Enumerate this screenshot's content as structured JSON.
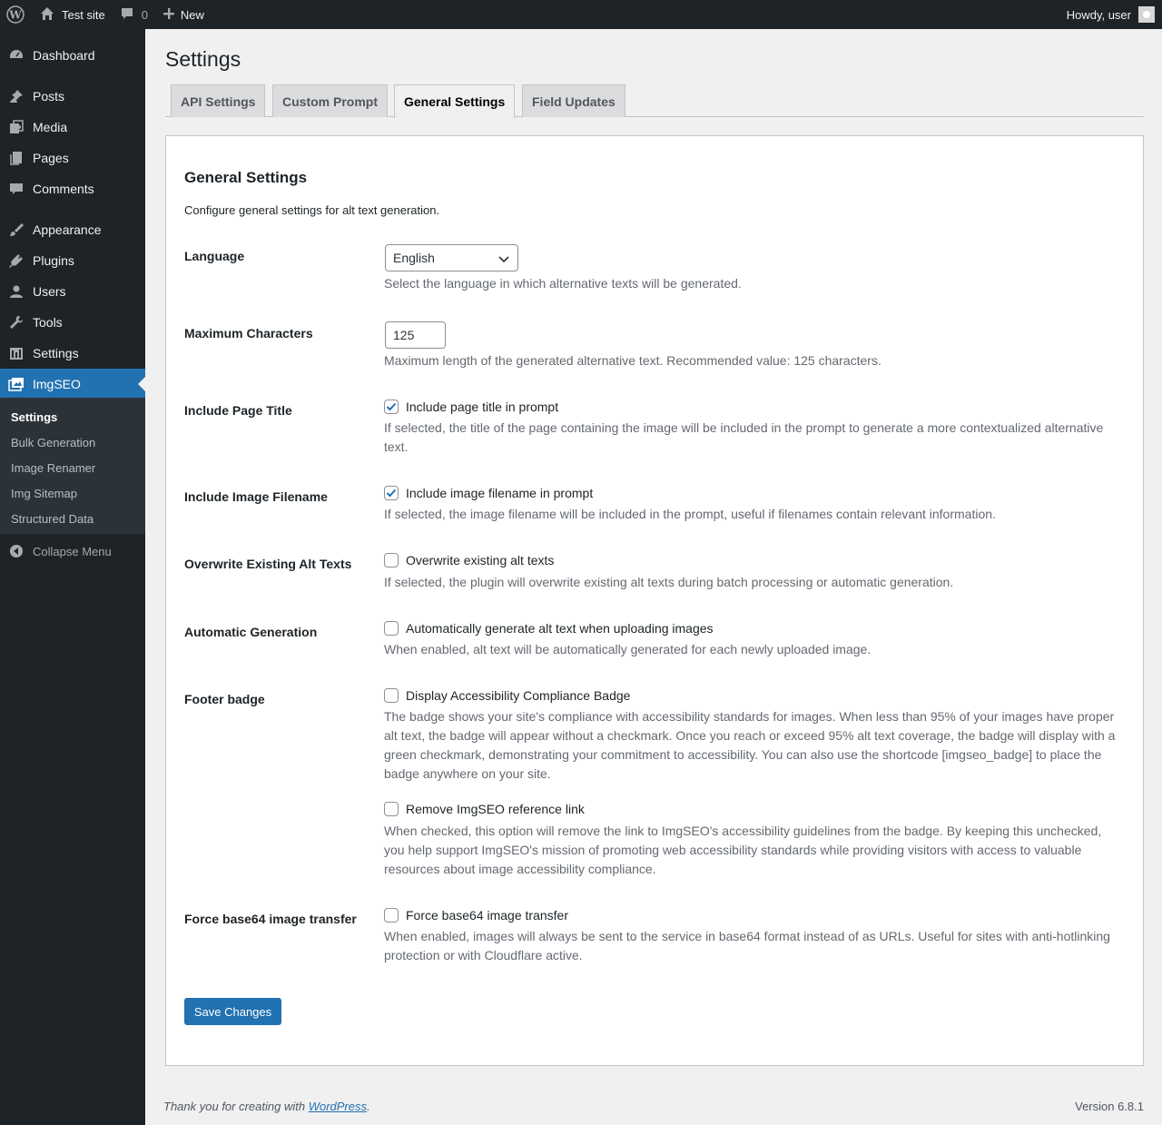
{
  "admin_bar": {
    "site_name": "Test site",
    "comments_count": "0",
    "new_label": "New",
    "greeting": "Howdy, user"
  },
  "sidebar": {
    "items": [
      {
        "label": "Dashboard",
        "icon": "dashboard-icon"
      },
      {
        "label": "Posts",
        "icon": "pin-icon"
      },
      {
        "label": "Media",
        "icon": "media-icon"
      },
      {
        "label": "Pages",
        "icon": "pages-icon"
      },
      {
        "label": "Comments",
        "icon": "comment-icon"
      },
      {
        "label": "Appearance",
        "icon": "brush-icon"
      },
      {
        "label": "Plugins",
        "icon": "plug-icon"
      },
      {
        "label": "Users",
        "icon": "user-icon"
      },
      {
        "label": "Tools",
        "icon": "wrench-icon"
      },
      {
        "label": "Settings",
        "icon": "settings-icon"
      },
      {
        "label": "ImgSEO",
        "icon": "images-icon"
      }
    ],
    "submenu": [
      "Settings",
      "Bulk Generation",
      "Image Renamer",
      "Img Sitemap",
      "Structured Data"
    ],
    "collapse_label": "Collapse Menu"
  },
  "page": {
    "title": "Settings",
    "tabs": [
      "API Settings",
      "Custom Prompt",
      "General Settings",
      "Field Updates"
    ],
    "active_tab": "General Settings"
  },
  "card": {
    "title": "General Settings",
    "intro": "Configure general settings for alt text generation.",
    "rows": {
      "language": {
        "label": "Language",
        "value": "English",
        "desc": "Select the language in which alternative texts will be generated."
      },
      "max_chars": {
        "label": "Maximum Characters",
        "value": "125",
        "desc": "Maximum length of the generated alternative text. Recommended value: 125 characters."
      },
      "page_title": {
        "label": "Include Page Title",
        "checkbox": "Include page title in prompt",
        "checked": true,
        "desc": "If selected, the title of the page containing the image will be included in the prompt to generate a more contextualized alternative text."
      },
      "filename": {
        "label": "Include Image Filename",
        "checkbox": "Include image filename in prompt",
        "checked": true,
        "desc": "If selected, the image filename will be included in the prompt, useful if filenames contain relevant information."
      },
      "overwrite": {
        "label": "Overwrite Existing Alt Texts",
        "checkbox": "Overwrite existing alt texts",
        "checked": false,
        "desc": "If selected, the plugin will overwrite existing alt texts during batch processing or automatic generation."
      },
      "auto": {
        "label": "Automatic Generation",
        "checkbox": "Automatically generate alt text when uploading images",
        "checked": false,
        "desc": "When enabled, alt text will be automatically generated for each newly uploaded image."
      },
      "badge": {
        "label": "Footer badge",
        "checkbox": "Display Accessibility Compliance Badge",
        "checked": false,
        "desc": "The badge shows your site's compliance with accessibility standards for images. When less than 95% of your images have proper alt text, the badge will appear without a checkmark. Once you reach or exceed 95% alt text coverage, the badge will display with a green checkmark, demonstrating your commitment to accessibility. You can also use the shortcode [imgseo_badge] to place the badge anywhere on your site.",
        "checkbox2": "Remove ImgSEO reference link",
        "checked2": false,
        "desc2": "When checked, this option will remove the link to ImgSEO's accessibility guidelines from the badge. By keeping this unchecked, you help support ImgSEO's mission of promoting web accessibility standards while providing visitors with access to valuable resources about image accessibility compliance."
      },
      "base64": {
        "label": "Force base64 image transfer",
        "checkbox": "Force base64 image transfer",
        "checked": false,
        "desc": "When enabled, images will always be sent to the service in base64 format instead of as URLs. Useful for sites with anti-hotlinking protection or with Cloudflare active."
      }
    },
    "save_label": "Save Changes"
  },
  "footer": {
    "thanks_prefix": "Thank you for creating with ",
    "thanks_link": "WordPress",
    "thanks_suffix": ".",
    "version": "Version 6.8.1"
  },
  "colors": {
    "admin_bar": "#1d2327",
    "accent": "#2271b1",
    "background": "#f0f0f1"
  }
}
